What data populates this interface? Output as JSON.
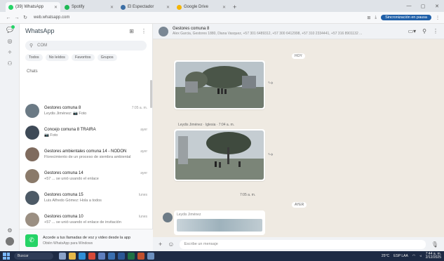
{
  "browser": {
    "tabs": [
      {
        "label": "(39) WhatsApp",
        "icon": "whatsapp-icon",
        "color": "#25d366",
        "active": true
      },
      {
        "label": "Spotify",
        "icon": "spotify-icon",
        "color": "#1db954",
        "active": false
      },
      {
        "label": "El Espectador",
        "icon": "news-icon",
        "color": "#3b6ea5",
        "active": false
      },
      {
        "label": "Google Drive",
        "icon": "drive-icon",
        "color": "#f4b400",
        "active": false
      }
    ],
    "url": "web.whatsapp.com",
    "pause_label": "Sincronización en pausa"
  },
  "sidebar": {
    "title": "WhatsApp",
    "search_value": "COM",
    "filters": [
      "Todos",
      "No leídos",
      "Favoritos",
      "Grupos"
    ],
    "section_label": "Chats",
    "chats": [
      {
        "name": "Gestores comuna 8",
        "preview": "Leydis Jiménez: 📷 Foto",
        "time": "7:05 a. m.",
        "color": "#6b7a85"
      },
      {
        "name": "Concejo comuna 8 TRAIRA",
        "preview": "📷 Foto",
        "time": "ayer",
        "color": "#3e4a57"
      },
      {
        "name": "Gestores ambientales comuna 14 - NODON",
        "preview": "Florecimiento de un proceso de siembra ambiental",
        "time": "ayer",
        "color": "#7f6b5e"
      },
      {
        "name": "Gestores comuna 14",
        "preview": "+57 ... se unió usando el enlace",
        "time": "ayer",
        "color": "#8a7a6a"
      },
      {
        "name": "Gestores comuna 15",
        "preview": "Luis Alfredo Gómez: Hola a todos",
        "time": "lunes",
        "color": "#4d5a66"
      },
      {
        "name": "Gestores comuna 10",
        "preview": "+57 ... se unió usando el enlace de invitación",
        "time": "lunes",
        "color": "#9b8f82"
      }
    ],
    "promo_title": "Accede a tus llamadas de voz y video desde la app",
    "promo_sub": "Obtén WhatsApp para Windows"
  },
  "conversation": {
    "name": "Gestores comuna 8",
    "members": "Alex Garcia, Gestores 1880, Diana Vasquez, +57 301 6489312, +57 300 6412998, +57 310 2334441, +57 316 8901132 ...",
    "date_label": "HOY",
    "caption1": "Leydis Jiménez · Iglesia · 7:04 a. m.",
    "time2": "7:05 a. m.",
    "date_label2": "AYER",
    "quote_sender": "Leydis Jiménez",
    "composer_placeholder": "Escribe un mensaje"
  },
  "taskbar": {
    "search_label": "Buscar",
    "tray_text": "ESP LAA",
    "temp": "25°C",
    "time": "7:44 a. m.",
    "date": "2/12/2025"
  }
}
